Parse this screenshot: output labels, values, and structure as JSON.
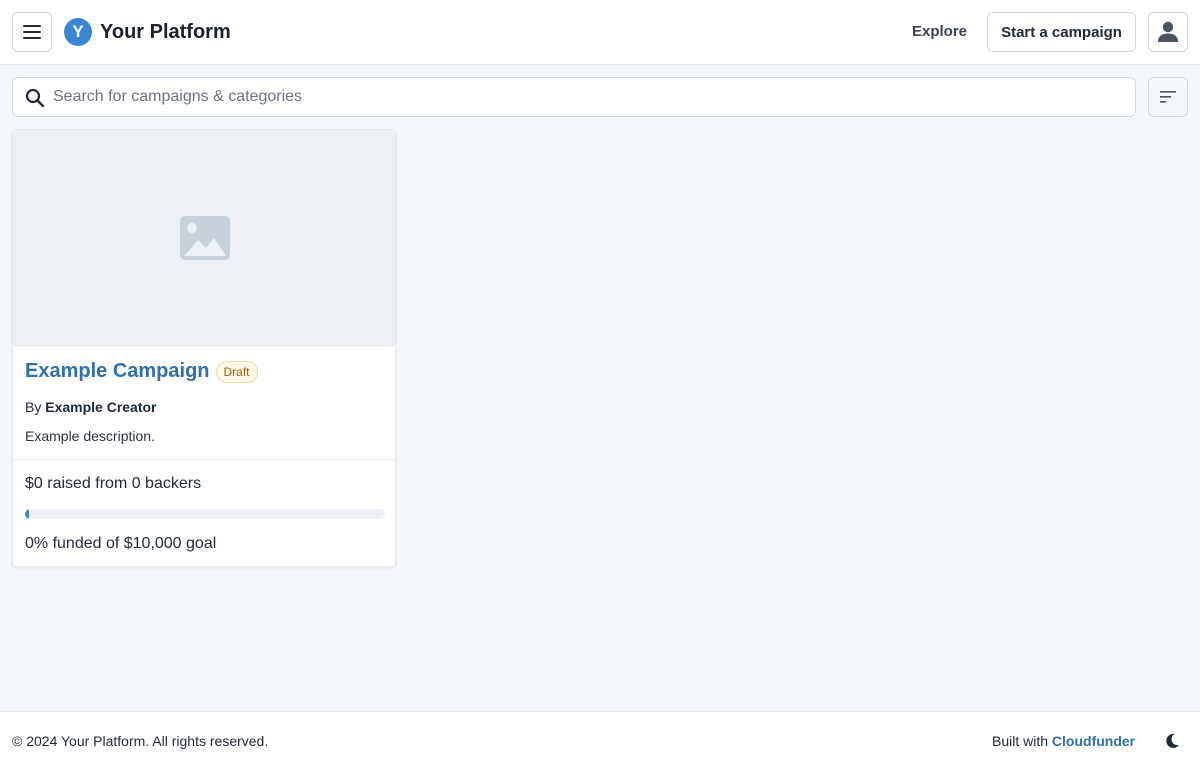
{
  "header": {
    "brand_initial": "Y",
    "brand_name": "Your Platform",
    "explore_label": "Explore",
    "start_campaign_label": "Start a campaign"
  },
  "search": {
    "placeholder": "Search for campaigns & categories",
    "value": ""
  },
  "card": {
    "title": "Example Campaign",
    "badge": "Draft",
    "by_prefix": "By",
    "creator": "Example Creator",
    "description": "Example description.",
    "raised_text": "$0 raised from 0 backers",
    "funded_fraction": 0.0,
    "funded_text": "0% funded of $10,000 goal"
  },
  "footer": {
    "copyright": "© 2024 Your Platform. All rights reserved.",
    "built_with_prefix": "Built with",
    "built_with_link": "Cloudfunder"
  },
  "icons": {
    "menu": "hamburger-icon",
    "user": "user-icon",
    "search": "search-icon",
    "filter": "sort-filter-icon",
    "image_placeholder": "image-placeholder-icon",
    "theme": "moon-icon"
  },
  "colors": {
    "accent": "#3a86d4",
    "link": "#2f6fac",
    "badge_text": "#a15c07"
  }
}
